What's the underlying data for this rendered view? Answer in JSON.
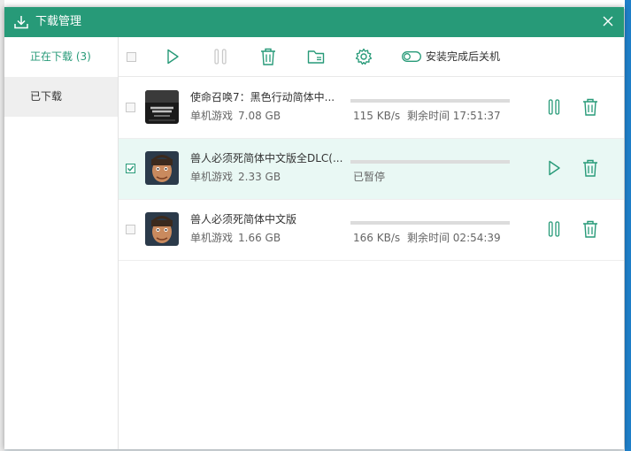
{
  "window": {
    "title": "下载管理"
  },
  "sidebar": {
    "tabs": [
      {
        "label": "正在下载 (3)"
      },
      {
        "label": "已下载"
      }
    ]
  },
  "toolbar": {
    "auto_shutdown_label": "安装完成后关机"
  },
  "downloads": [
    {
      "name": "使命召唤7：黑色行动简体中...",
      "category": "单机游戏",
      "size": "7.08 GB",
      "speed": "115 KB/s",
      "remaining_label": "剩余时间",
      "remaining": "17:51:37",
      "state": "downloading",
      "checked": false
    },
    {
      "name": "兽人必须死简体中文版全DLC(...",
      "category": "单机游戏",
      "size": "2.33 GB",
      "status_text": "已暂停",
      "state": "paused",
      "checked": true
    },
    {
      "name": "兽人必须死简体中文版",
      "category": "单机游戏",
      "size": "1.66 GB",
      "speed": "166 KB/s",
      "remaining_label": "剩余时间",
      "remaining": "02:54:39",
      "state": "downloading",
      "checked": false
    }
  ],
  "colors": {
    "accent": "#279a78",
    "selected_row": "#e9f8f4"
  },
  "icons": {
    "toolbar": [
      "play-icon",
      "pause-icon",
      "trash-icon",
      "folder-icon",
      "gear-icon",
      "toggle-switch"
    ],
    "title": "download-icon"
  }
}
